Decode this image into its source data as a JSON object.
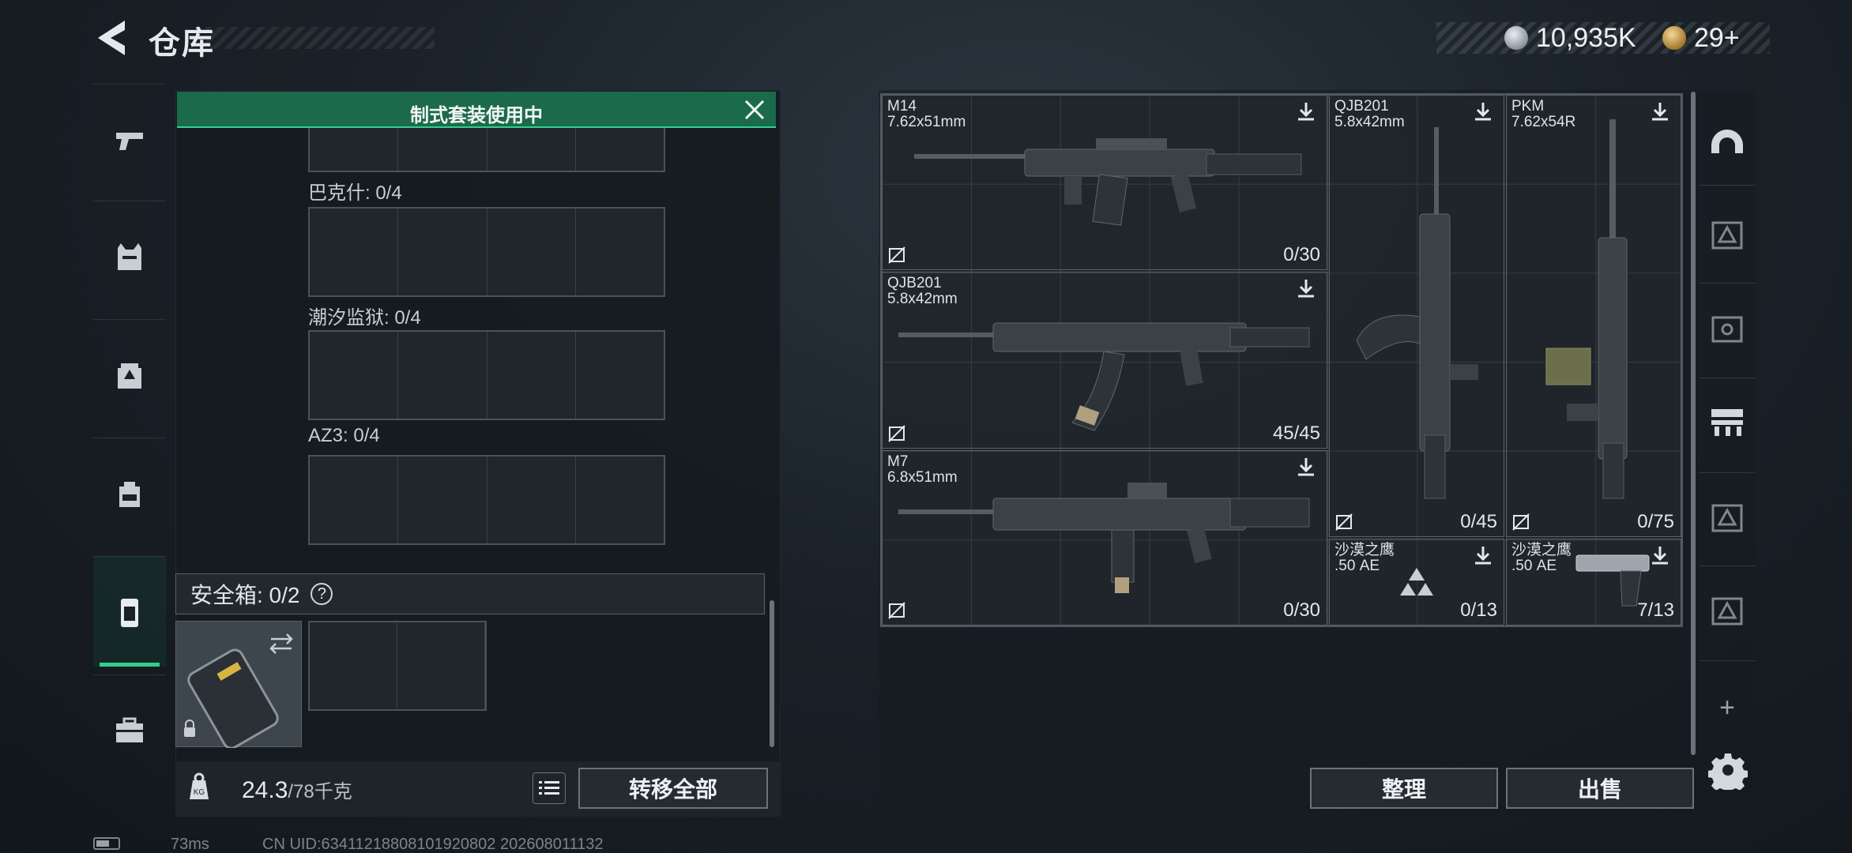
{
  "header": {
    "title": "仓库",
    "currency_main": "10,935K",
    "currency_secondary": "29+"
  },
  "left_nav": {
    "items": [
      "pistol-icon",
      "vest-icon",
      "backpack-icon",
      "chest-rig-icon",
      "secure-case-icon",
      "toolbox-icon"
    ],
    "active_index": 4
  },
  "banner": {
    "text": "制式套装使用中"
  },
  "slots": [
    {
      "label": "巴克什: 0/4"
    },
    {
      "label": "潮汐监狱: 0/4"
    },
    {
      "label": "AZ3: 0/4"
    }
  ],
  "safebox": {
    "label": "安全箱: 0/2",
    "help": "?"
  },
  "footer": {
    "weight_value": "24.3",
    "weight_max": "/78千克",
    "transfer_all": "转移全部"
  },
  "items": [
    {
      "name": "M14",
      "caliber": "7.62x51mm",
      "count": "0/30"
    },
    {
      "name": "QJB201",
      "caliber": "5.8x42mm",
      "count": "45/45"
    },
    {
      "name": "M7",
      "caliber": "6.8x51mm",
      "count": "0/30"
    },
    {
      "name": "QJB201",
      "caliber": "5.8x42mm",
      "count": "0/45"
    },
    {
      "name": "PKM",
      "caliber": "7.62x54R",
      "count": "0/75"
    },
    {
      "name": "沙漠之鹰",
      "caliber": ".50 AE",
      "count": "0/13"
    },
    {
      "name": "沙漠之鹰",
      "caliber": ".50 AE",
      "count": "7/13"
    }
  ],
  "right_nav": {
    "items": [
      "helmet-icon",
      "case-icon-1",
      "case-icon-2",
      "rack-icon",
      "case-icon-3",
      "case-icon-4"
    ],
    "add": "+"
  },
  "actions": {
    "sort": "整理",
    "sell": "出售"
  },
  "status": {
    "ping": "73ms",
    "uid": "CN UID:634112188081019208​02 202608011132"
  },
  "colors": {
    "accent_green": "#2fd08a",
    "banner_green": "#1c6a4c"
  }
}
